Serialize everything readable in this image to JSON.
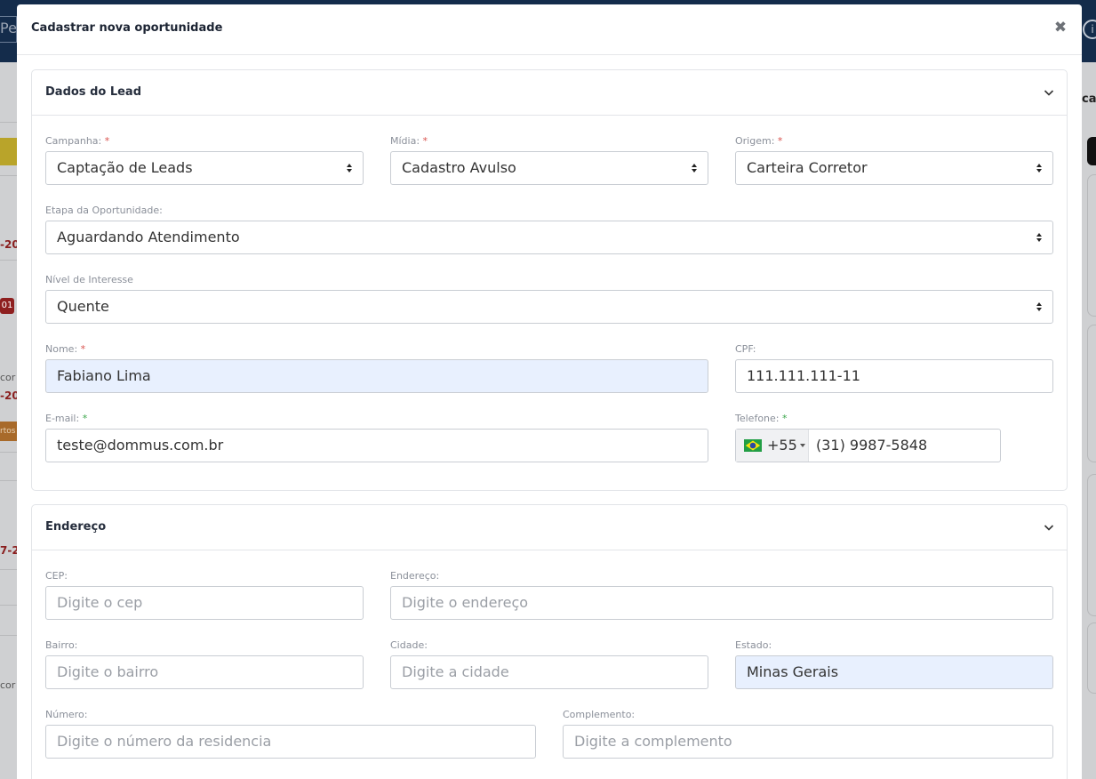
{
  "background": {
    "top_left_fragment": "Pe",
    "right_fragment": "cal",
    "badge_text": "01",
    "orange_text": "rtos",
    "frag_20a": "-20",
    "frag_20b": "-20",
    "frag_20c": "7-2",
    "frag_con1": "cor",
    "frag_con2": "cor",
    "info_glyph": "i"
  },
  "modal": {
    "title": "Cadastrar nova oportunidade",
    "close_glyph": "✖"
  },
  "lead_section": {
    "title": "Dados do Lead",
    "campanha": {
      "label": "Campanha:",
      "required": "*",
      "value": "Captação de Leads"
    },
    "midia": {
      "label": "Mídia:",
      "required": "*",
      "value": "Cadastro Avulso"
    },
    "origem": {
      "label": "Origem:",
      "required": "*",
      "value": "Carteira Corretor"
    },
    "etapa": {
      "label": "Etapa da Oportunidade:",
      "value": "Aguardando Atendimento"
    },
    "nivel": {
      "label": "Nível de Interesse",
      "value": "Quente"
    },
    "nome": {
      "label": "Nome:",
      "required": "*",
      "value": "Fabiano Lima"
    },
    "cpf": {
      "label": "CPF:",
      "value": "111.111.111-11"
    },
    "email": {
      "label": "E-mail:",
      "required": "*",
      "value": "teste@dommus.com.br"
    },
    "telefone": {
      "label": "Telefone:",
      "required": "*",
      "dial_code": "+55",
      "value": "(31) 9987-5848"
    }
  },
  "address_section": {
    "title": "Endereço",
    "cep": {
      "label": "CEP:",
      "placeholder": "Digite o cep"
    },
    "endereco": {
      "label": "Endereço:",
      "placeholder": "Digite o endereço"
    },
    "bairro": {
      "label": "Bairro:",
      "placeholder": "Digite o bairro"
    },
    "cidade": {
      "label": "Cidade:",
      "placeholder": "Digite a cidade"
    },
    "estado": {
      "label": "Estado:",
      "value": "Minas Gerais"
    },
    "numero": {
      "label": "Número:",
      "placeholder": "Digite o número da residencia"
    },
    "complemento": {
      "label": "Complemento:",
      "placeholder": "Digite a complemento"
    }
  },
  "colors": {
    "autofill_bg": "#e8f0fe",
    "required_red": "#d9534f",
    "required_green": "#3aa54a",
    "topbar": "#142c4b"
  }
}
